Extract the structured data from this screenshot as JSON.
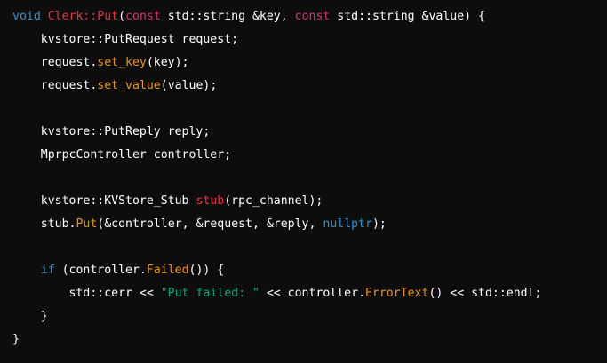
{
  "code": {
    "language": "cpp",
    "lines": [
      [
        {
          "t": "void ",
          "c": "keyword"
        },
        {
          "t": "Clerk::Put",
          "c": "func"
        },
        {
          "t": "(",
          "c": "plain"
        },
        {
          "t": "const",
          "c": "type"
        },
        {
          "t": " std::string &key, ",
          "c": "plain"
        },
        {
          "t": "const",
          "c": "type"
        },
        {
          "t": " std::string &value) {",
          "c": "plain"
        }
      ],
      [
        {
          "t": "    kvstore::PutRequest request;",
          "c": "plain"
        }
      ],
      [
        {
          "t": "    request.",
          "c": "plain"
        },
        {
          "t": "set_key",
          "c": "method"
        },
        {
          "t": "(key);",
          "c": "plain"
        }
      ],
      [
        {
          "t": "    request.",
          "c": "plain"
        },
        {
          "t": "set_value",
          "c": "method"
        },
        {
          "t": "(value);",
          "c": "plain"
        }
      ],
      [],
      [
        {
          "t": "    kvstore::PutReply reply;",
          "c": "plain"
        }
      ],
      [
        {
          "t": "    MprpcController controller;",
          "c": "plain"
        }
      ],
      [],
      [
        {
          "t": "    kvstore::KVStore_Stub ",
          "c": "plain"
        },
        {
          "t": "stub",
          "c": "func"
        },
        {
          "t": "(rpc_channel);",
          "c": "plain"
        }
      ],
      [
        {
          "t": "    stub.",
          "c": "plain"
        },
        {
          "t": "Put",
          "c": "method"
        },
        {
          "t": "(&controller, &request, &reply, ",
          "c": "plain"
        },
        {
          "t": "nullptr",
          "c": "keyword"
        },
        {
          "t": ");",
          "c": "plain"
        }
      ],
      [],
      [
        {
          "t": "    ",
          "c": "plain"
        },
        {
          "t": "if",
          "c": "keyword"
        },
        {
          "t": " (controller.",
          "c": "plain"
        },
        {
          "t": "Failed",
          "c": "method"
        },
        {
          "t": "()) {",
          "c": "plain"
        }
      ],
      [
        {
          "t": "        std::cerr << ",
          "c": "plain"
        },
        {
          "t": "\"Put failed: \"",
          "c": "string"
        },
        {
          "t": " << controller.",
          "c": "plain"
        },
        {
          "t": "ErrorText",
          "c": "method"
        },
        {
          "t": "() << std::endl;",
          "c": "plain"
        }
      ],
      [
        {
          "t": "    }",
          "c": "plain"
        }
      ],
      [
        {
          "t": "}",
          "c": "plain"
        }
      ]
    ]
  },
  "colors": {
    "background": "#0d0d0d",
    "plain": "#ffffff",
    "keyword": "#2e95d3",
    "type": "#df3079",
    "func": "#f22c3d",
    "method": "#e9950c",
    "string": "#00a67d"
  }
}
